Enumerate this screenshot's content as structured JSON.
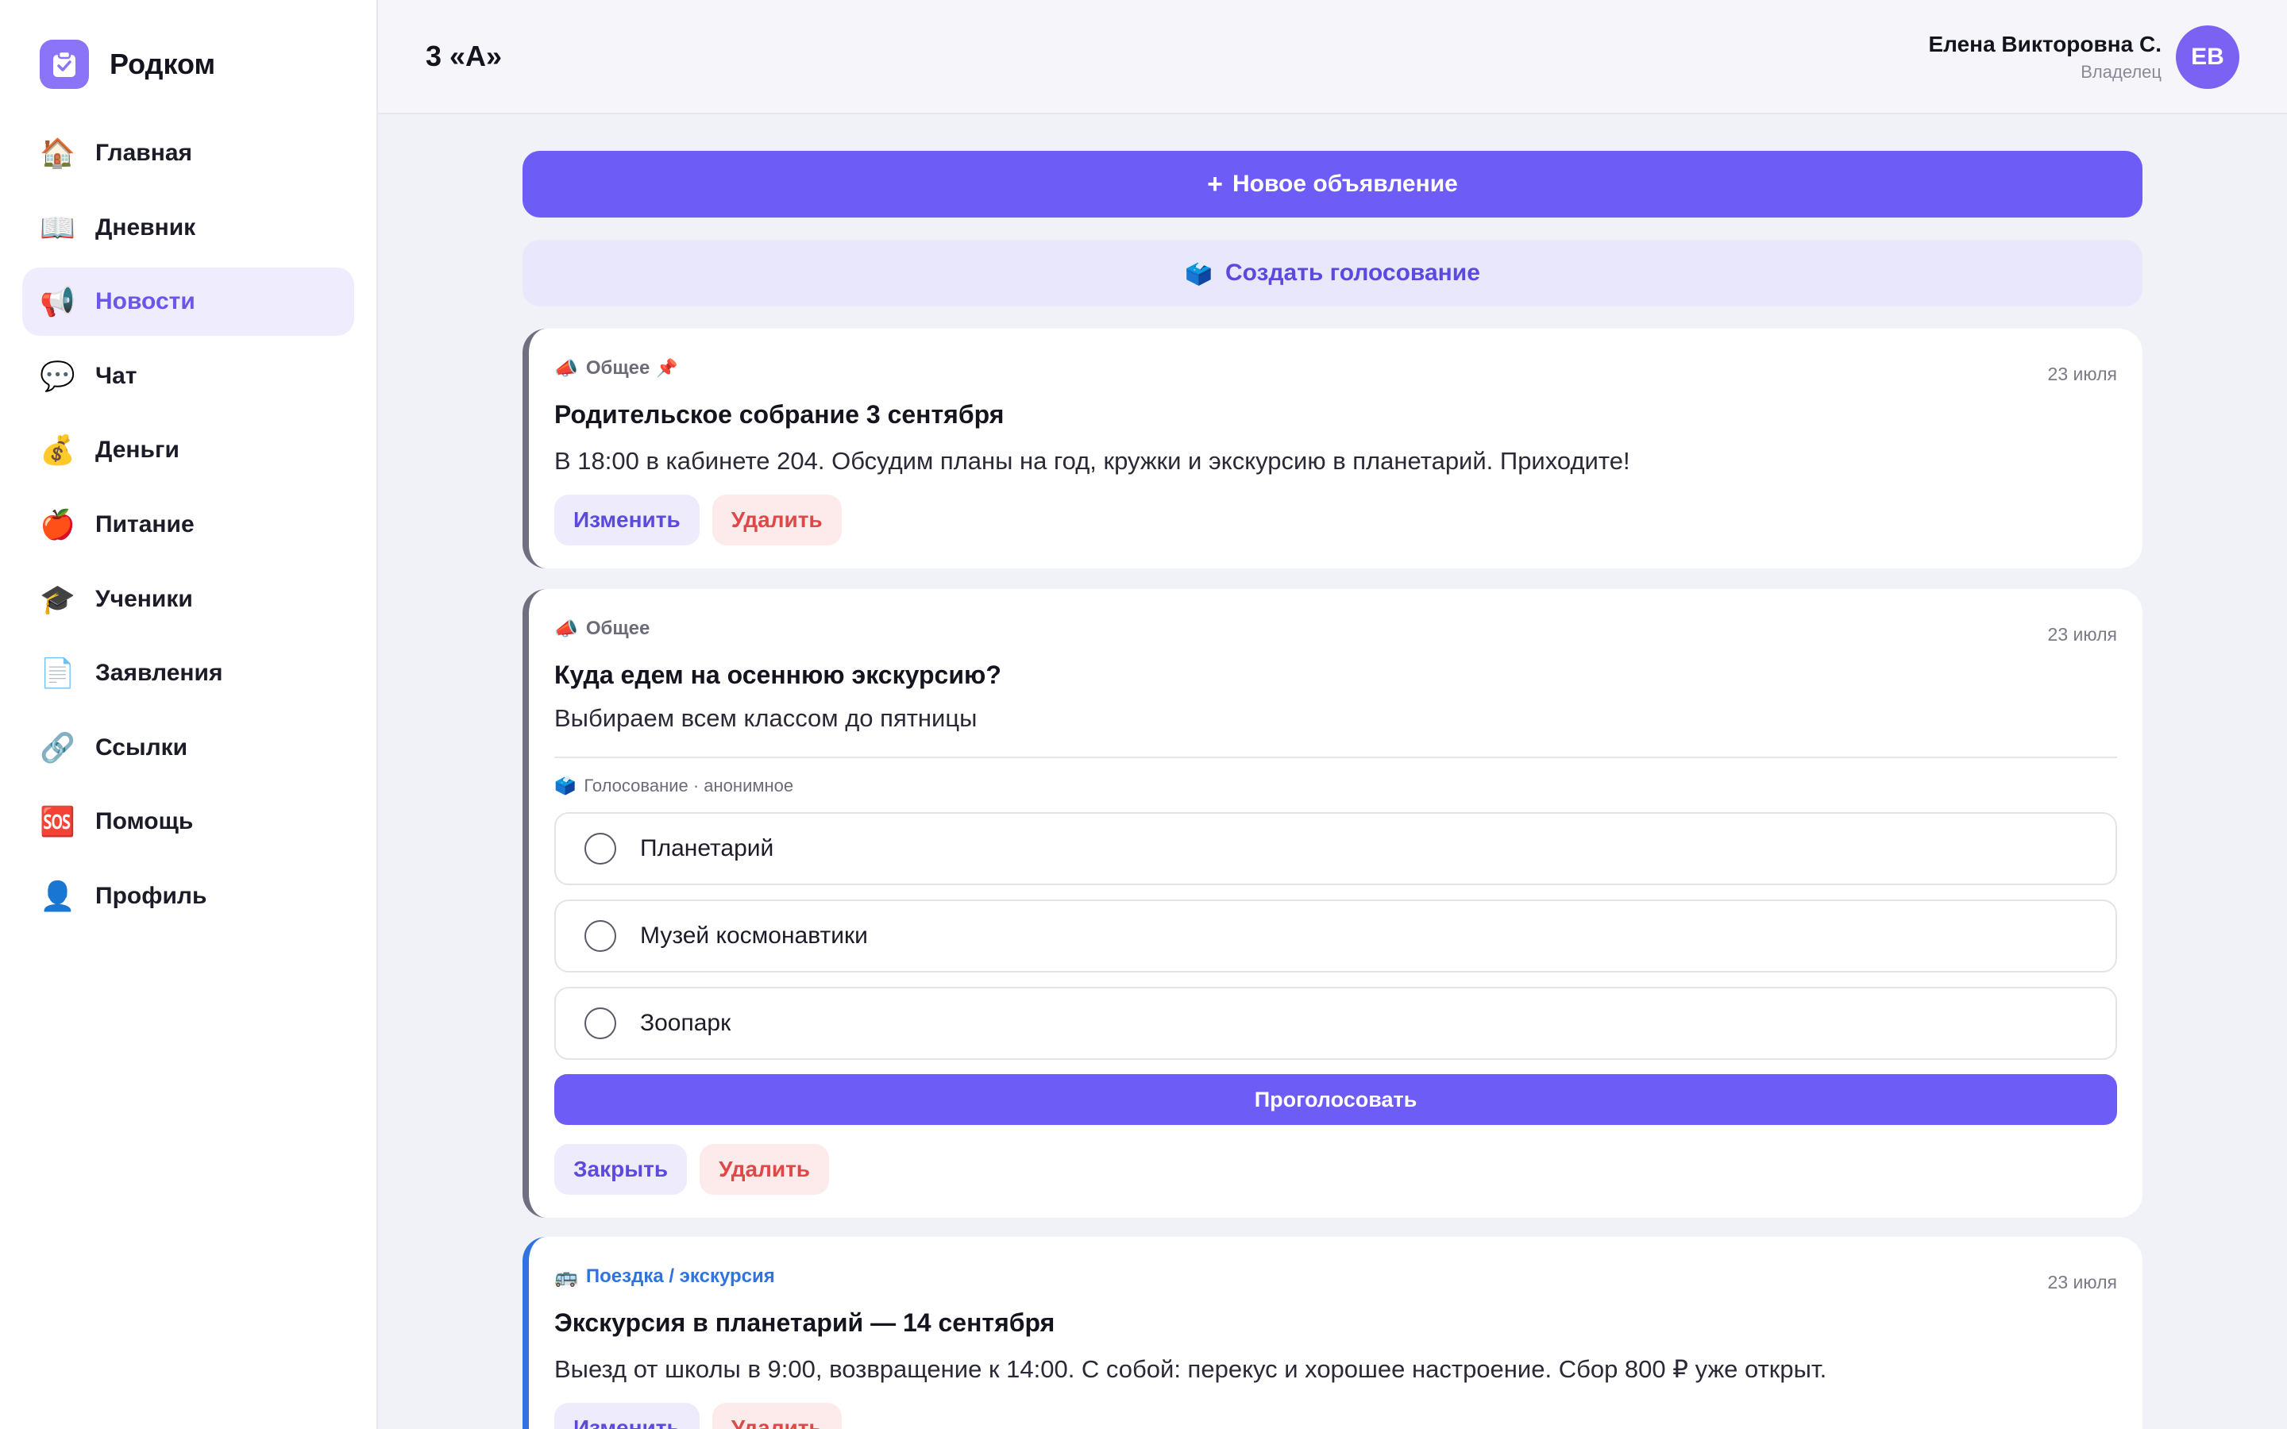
{
  "app": {
    "name": "Родком"
  },
  "sidebar": {
    "items": [
      {
        "icon": "🏠",
        "icon_name": "house-icon",
        "label": "Главная",
        "active": false
      },
      {
        "icon": "📖",
        "icon_name": "book-icon",
        "label": "Дневник",
        "active": false
      },
      {
        "icon": "📢",
        "icon_name": "megaphone-icon",
        "label": "Новости",
        "active": true
      },
      {
        "icon": "💬",
        "icon_name": "speech-bubble-icon",
        "label": "Чат",
        "active": false
      },
      {
        "icon": "💰",
        "icon_name": "money-bag-icon",
        "label": "Деньги",
        "active": false
      },
      {
        "icon": "🍎",
        "icon_name": "apple-icon",
        "label": "Питание",
        "active": false
      },
      {
        "icon": "🎓",
        "icon_name": "graduation-cap-icon",
        "label": "Ученики",
        "active": false
      },
      {
        "icon": "📄",
        "icon_name": "document-icon",
        "label": "Заявления",
        "active": false
      },
      {
        "icon": "🔗",
        "icon_name": "link-icon",
        "label": "Ссылки",
        "active": false
      },
      {
        "icon": "🆘",
        "icon_name": "sos-icon",
        "label": "Помощь",
        "active": false
      },
      {
        "icon": "👤",
        "icon_name": "person-icon",
        "label": "Профиль",
        "active": false
      }
    ]
  },
  "header": {
    "class_title": "3 «А»",
    "user_name": "Елена Викторовна С.",
    "user_role": "Владелец",
    "avatar_initials": "ЕВ"
  },
  "main": {
    "new_announcement": "Новое объявление",
    "create_poll": "Создать голосование",
    "create_poll_icon": "🗳️"
  },
  "posts": [
    {
      "tag": "Общее",
      "tag_icon": "📣",
      "pinned": true,
      "pin_icon": "📌",
      "date": "23 июля",
      "title": "Родительское собрание 3 сентября",
      "text": "В 18:00 в кабинете 204. Обсудим планы на год, кружки и экскурсию в планетарий. Приходите!",
      "edit": "Изменить",
      "delete": "Удалить"
    },
    {
      "tag": "Общее",
      "tag_icon": "📣",
      "date": "23 июля",
      "title": "Куда едем на осеннюю экскурсию?",
      "text": "Выбираем всем классом до пятницы",
      "poll_meta": "Голосование · анонимное",
      "poll_icon": "🗳️",
      "options": [
        "Планетарий",
        "Музей космонавтики",
        "Зоопарк"
      ],
      "vote": "Проголосовать",
      "close": "Закрыть",
      "delete": "Удалить"
    },
    {
      "tag": "Поездка / экскурсия",
      "tag_icon": "🚌",
      "date": "23 июля",
      "title": "Экскурсия в планетарий — 14 сентября",
      "text": "Выезд от школы в 9:00, возвращение к 14:00. С собой: перекус и хорошее настроение. Сбор 800 ₽ уже открыт.",
      "edit": "Изменить",
      "delete": "Удалить"
    }
  ],
  "colors": {
    "accent": "#6e5cf7",
    "danger": "#e04848",
    "trip": "#2f73e0"
  }
}
